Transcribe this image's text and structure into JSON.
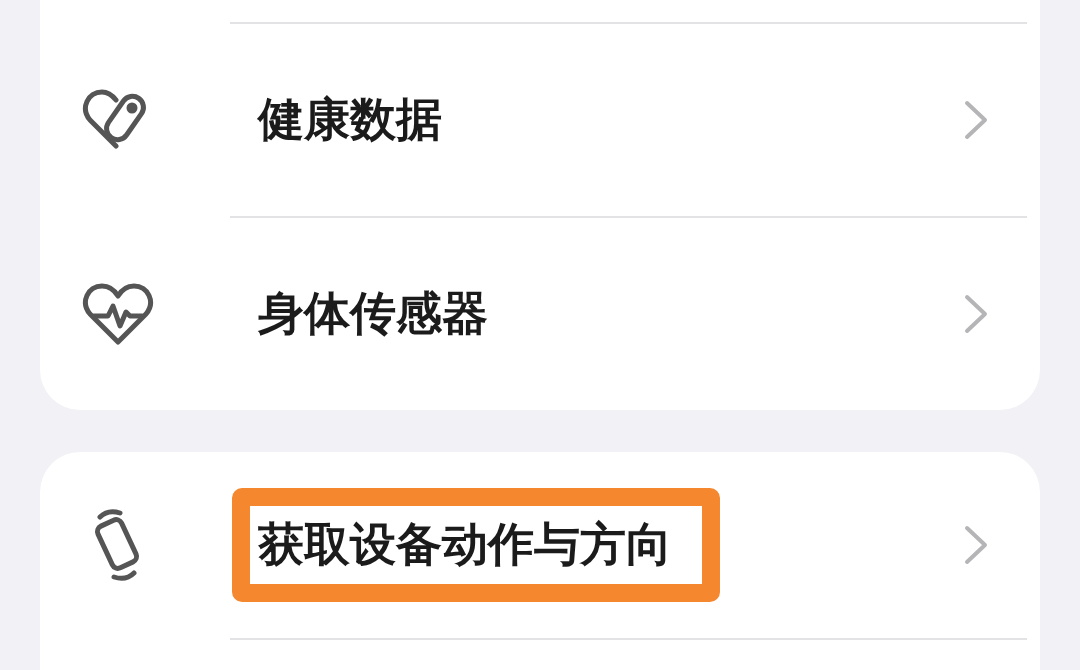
{
  "groups": [
    {
      "items": [
        {
          "kind": "health",
          "label": "健康数据",
          "highlighted": false
        },
        {
          "kind": "sensor",
          "label": "身体传感器",
          "highlighted": false
        }
      ]
    },
    {
      "items": [
        {
          "kind": "motion",
          "label": "获取设备动作与方向",
          "highlighted": true
        }
      ]
    }
  ]
}
